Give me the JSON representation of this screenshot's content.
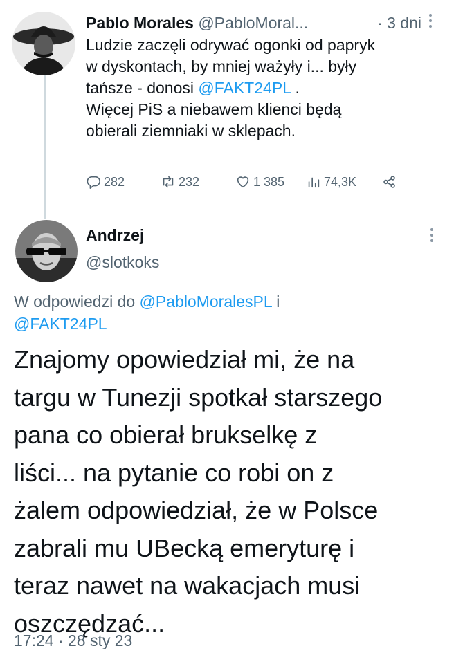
{
  "original_tweet": {
    "author_name": "Pablo Morales",
    "handle": "@PabloMoral...",
    "separator": "·",
    "time": "3 dni",
    "text_lines": [
      "Ludzie zaczęli odrywać ogonki od papryk",
      "w dyskontach, by mniej ważyły i... były"
    ],
    "line3_prefix": "tańsze - donosi ",
    "line3_mention": "@FAKT24PL",
    "line3_suffix": " .",
    "text_lines_after": [
      "Więcej PiS a niebawem klienci będą",
      "obierali ziemniaki w sklepach."
    ],
    "stats": {
      "replies": "282",
      "retweets": "232",
      "likes": "1 385",
      "views": "74,3K"
    },
    "icons": [
      "reply-icon",
      "retweet-icon",
      "like-icon",
      "views-icon",
      "share-icon"
    ]
  },
  "reply_tweet": {
    "author_name": "Andrzej",
    "handle": "@slotkoks",
    "reply_prefix": "W odpowiedzi do ",
    "reply_mention_1": "@PabloMoralesPL",
    "reply_conjunction": " i",
    "reply_mention_2": "@FAKT24PL",
    "text_lines": [
      "Znajomy opowiedział mi, że na",
      "targu w Tunezji spotkał starszego",
      "pana co obierał brukselkę z",
      "liści... na pytanie co robi on z",
      "żalem odpowiedział, że w Polsce",
      "zabrali mu UBecką emeryturę i",
      "teraz nawet na wakacjach musi",
      "oszczędzać..."
    ],
    "timestamp": "17:24 · 28 sty 23"
  },
  "colors": {
    "text": "#0f1419",
    "secondary": "#536471",
    "link": "#1d9bf0",
    "thread_line": "#cfd9de"
  }
}
